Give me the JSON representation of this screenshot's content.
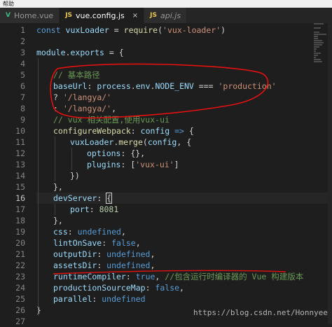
{
  "menubar": {
    "label": "帮助"
  },
  "tabs": [
    {
      "label": "Home.vue",
      "icon": "vue-file-icon",
      "icon_glyph": "V",
      "icon_color": "#41b883",
      "active": false,
      "italic": false,
      "close": false
    },
    {
      "label": "vue.config.js",
      "icon": "js-file-icon",
      "icon_glyph": "JS",
      "icon_color": "#e6c84b",
      "active": true,
      "italic": false,
      "close": true
    },
    {
      "label": "api.js",
      "icon": "js-file-icon",
      "icon_glyph": "JS",
      "icon_color": "#e6c84b",
      "active": false,
      "italic": true,
      "close": false
    }
  ],
  "colors": {
    "keyword": "#569cd6",
    "function": "#dcdcaa",
    "string": "#ce9178",
    "property": "#9cdcfe",
    "comment": "#6a9955",
    "number": "#b5cea8",
    "plain": "#d4d4d4",
    "annotation": "#e51010"
  },
  "current_line": 16,
  "lines": [
    {
      "n": "1",
      "indent": 0,
      "tokens": [
        [
          "kw",
          "const "
        ],
        [
          "var",
          "vuxLoader"
        ],
        [
          "p",
          " = "
        ],
        [
          "fn",
          "require"
        ],
        [
          "p",
          "("
        ],
        [
          "str",
          "'vux-loader'"
        ],
        [
          "p",
          ")"
        ]
      ]
    },
    {
      "n": "2",
      "indent": 0,
      "tokens": []
    },
    {
      "n": "3",
      "indent": 0,
      "tokens": [
        [
          "var",
          "module"
        ],
        [
          "p",
          "."
        ],
        [
          "var",
          "exports"
        ],
        [
          "p",
          " = {"
        ]
      ]
    },
    {
      "n": "4",
      "indent": 0,
      "tokens": []
    },
    {
      "n": "5",
      "indent": 1,
      "tokens": [
        [
          "cm",
          "// 基本路径"
        ]
      ]
    },
    {
      "n": "6",
      "indent": 1,
      "tokens": [
        [
          "var",
          "baseUrl"
        ],
        [
          "p",
          ": "
        ],
        [
          "var",
          "process"
        ],
        [
          "p",
          "."
        ],
        [
          "var",
          "env"
        ],
        [
          "p",
          "."
        ],
        [
          "var",
          "NODE_ENV"
        ],
        [
          "p",
          " === "
        ],
        [
          "str",
          "'production'"
        ]
      ]
    },
    {
      "n": "7",
      "indent": 1,
      "tokens": [
        [
          "p",
          "? "
        ],
        [
          "str",
          "'/langya/'"
        ]
      ]
    },
    {
      "n": "8",
      "indent": 1,
      "tokens": [
        [
          "p",
          ": "
        ],
        [
          "str",
          "'/langya/'"
        ],
        [
          "p",
          ","
        ]
      ]
    },
    {
      "n": "9",
      "indent": 1,
      "tokens": [
        [
          "cm",
          "// vux 相关配置,使用vux-ui"
        ]
      ]
    },
    {
      "n": "10",
      "indent": 1,
      "tokens": [
        [
          "fn",
          "configureWebpack"
        ],
        [
          "p",
          ": "
        ],
        [
          "var",
          "config"
        ],
        [
          "p",
          " "
        ],
        [
          "kw",
          "=>"
        ],
        [
          "p",
          " {"
        ]
      ]
    },
    {
      "n": "11",
      "indent": 2,
      "tokens": [
        [
          "var",
          "vuxLoader"
        ],
        [
          "p",
          "."
        ],
        [
          "fn",
          "merge"
        ],
        [
          "p",
          "("
        ],
        [
          "var",
          "config"
        ],
        [
          "p",
          ", {"
        ]
      ]
    },
    {
      "n": "12",
      "indent": 3,
      "tokens": [
        [
          "var",
          "options"
        ],
        [
          "p",
          ": {},"
        ]
      ]
    },
    {
      "n": "13",
      "indent": 3,
      "tokens": [
        [
          "var",
          "plugins"
        ],
        [
          "p",
          ": ["
        ],
        [
          "str",
          "'vux-ui'"
        ],
        [
          "p",
          "]"
        ]
      ]
    },
    {
      "n": "14",
      "indent": 2,
      "tokens": [
        [
          "p",
          "})"
        ]
      ]
    },
    {
      "n": "15",
      "indent": 1,
      "tokens": [
        [
          "p",
          "},"
        ]
      ]
    },
    {
      "n": "16",
      "indent": 1,
      "tokens": [
        [
          "var",
          "devServer"
        ],
        [
          "p",
          ": "
        ],
        [
          "box",
          "{"
        ]
      ]
    },
    {
      "n": "17",
      "indent": 2,
      "tokens": [
        [
          "var",
          "port"
        ],
        [
          "p",
          ": "
        ],
        [
          "num",
          "8081"
        ]
      ]
    },
    {
      "n": "18",
      "indent": 1,
      "tokens": [
        [
          "p",
          "},"
        ]
      ]
    },
    {
      "n": "19",
      "indent": 1,
      "tokens": [
        [
          "var",
          "css"
        ],
        [
          "p",
          ": "
        ],
        [
          "kw",
          "undefined"
        ],
        [
          "p",
          ","
        ]
      ]
    },
    {
      "n": "20",
      "indent": 1,
      "tokens": [
        [
          "var",
          "lintOnSave"
        ],
        [
          "p",
          ": "
        ],
        [
          "kw",
          "false"
        ],
        [
          "p",
          ","
        ]
      ]
    },
    {
      "n": "21",
      "indent": 1,
      "tokens": [
        [
          "var",
          "outputDir"
        ],
        [
          "p",
          ": "
        ],
        [
          "kw",
          "undefined"
        ],
        [
          "p",
          ","
        ]
      ]
    },
    {
      "n": "22",
      "indent": 1,
      "tokens": [
        [
          "var",
          "assetsDir"
        ],
        [
          "p",
          ": "
        ],
        [
          "kw",
          "undefined"
        ],
        [
          "p",
          ","
        ]
      ]
    },
    {
      "n": "23",
      "indent": 1,
      "tokens": [
        [
          "var",
          "runtimeCompiler"
        ],
        [
          "p",
          ": "
        ],
        [
          "kw",
          "true"
        ],
        [
          "p",
          ", "
        ],
        [
          "cm",
          "//包含运行时编译器的 Vue 构建版本"
        ]
      ]
    },
    {
      "n": "24",
      "indent": 1,
      "tokens": [
        [
          "var",
          "productionSourceMap"
        ],
        [
          "p",
          ": "
        ],
        [
          "kw",
          "false"
        ],
        [
          "p",
          ","
        ]
      ]
    },
    {
      "n": "25",
      "indent": 1,
      "tokens": [
        [
          "var",
          "parallel"
        ],
        [
          "p",
          ": "
        ],
        [
          "kw",
          "undefined"
        ]
      ]
    },
    {
      "n": "26",
      "indent": 0,
      "tokens": [
        [
          "p",
          "}"
        ]
      ]
    },
    {
      "n": "27",
      "indent": 0,
      "tokens": []
    }
  ],
  "watermark": "https://blog.csdn.net/Honnyee"
}
